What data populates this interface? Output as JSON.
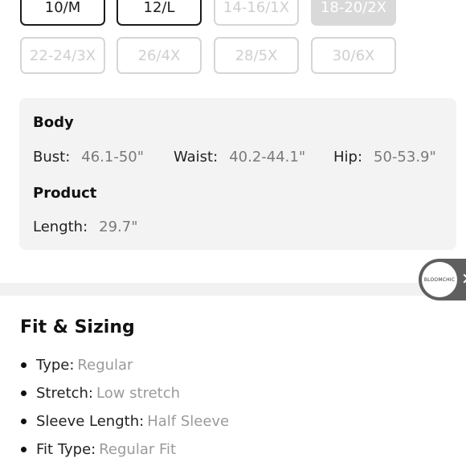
{
  "size_options": [
    {
      "label": "10/M",
      "state": "available"
    },
    {
      "label": "12/L",
      "state": "available"
    },
    {
      "label": "14-16/1X",
      "state": "unavailable"
    },
    {
      "label": "18-20/2X",
      "state": "selected"
    },
    {
      "label": "22-24/3X",
      "state": "unavailable"
    },
    {
      "label": "26/4X",
      "state": "unavailable"
    },
    {
      "label": "28/5X",
      "state": "unavailable"
    },
    {
      "label": "30/6X",
      "state": "unavailable"
    }
  ],
  "measurements": {
    "body_heading": "Body",
    "bust_label": "Bust:",
    "bust_value": "46.1-50\"",
    "waist_label": "Waist:",
    "waist_value": "40.2-44.1\"",
    "hip_label": "Hip:",
    "hip_value": "50-53.9\"",
    "product_heading": "Product",
    "length_label": "Length:",
    "length_value": "29.7\""
  },
  "floating_badge": {
    "logo_text": "BLOOMCHIC",
    "close_icon": "close-icon"
  },
  "fit_sizing": {
    "title": "Fit & Sizing",
    "items": [
      {
        "label": "Type:",
        "value": "Regular"
      },
      {
        "label": "Stretch:",
        "value": "Low stretch"
      },
      {
        "label": "Sleeve Length:",
        "value": "Half Sleeve"
      },
      {
        "label": "Fit Type:",
        "value": "Regular Fit"
      }
    ]
  },
  "colors": {
    "selected_size_bg": "#d9d9d9",
    "card_bg": "#f3f3f3",
    "badge_bg": "#5f5f5f"
  }
}
